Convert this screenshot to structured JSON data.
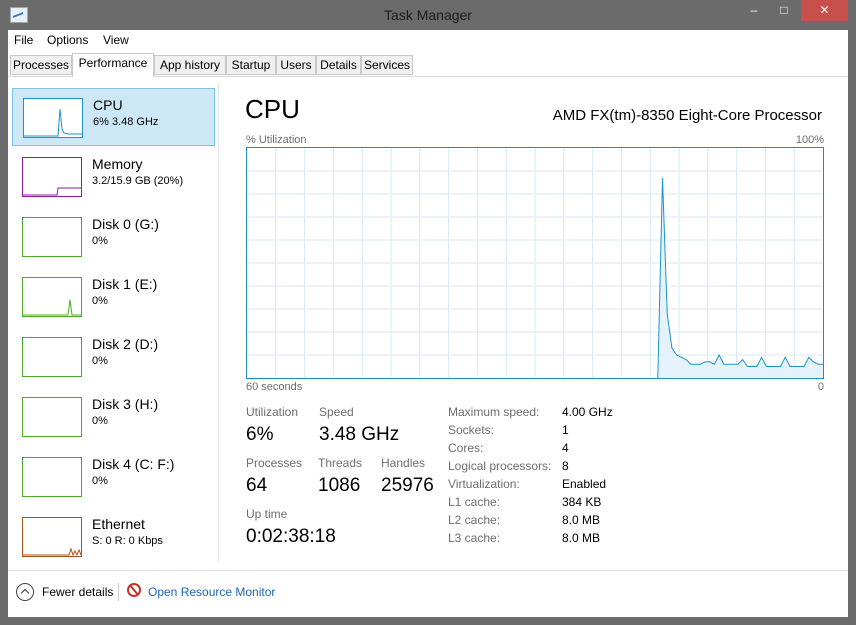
{
  "window": {
    "title": "Task Manager"
  },
  "window_controls": {
    "minimize": "–",
    "maximize": "□",
    "close": "✕"
  },
  "menu": [
    "File",
    "Options",
    "View"
  ],
  "tabs": [
    "Processes",
    "Performance",
    "App history",
    "Startup",
    "Users",
    "Details",
    "Services"
  ],
  "active_tab": "Performance",
  "sidebar": {
    "items": [
      {
        "name": "CPU",
        "sub": "6% 3.48 GHz",
        "color": "#1a94cb",
        "selected": true
      },
      {
        "name": "Memory",
        "sub": "3.2/15.9 GB (20%)",
        "color": "#8b1c9e"
      },
      {
        "name": "Disk 0 (G:)",
        "sub": "0%",
        "color": "#4da82a"
      },
      {
        "name": "Disk 1 (E:)",
        "sub": "0%",
        "color": "#4da82a"
      },
      {
        "name": "Disk 2 (D:)",
        "sub": "0%",
        "color": "#4da82a"
      },
      {
        "name": "Disk 3 (H:)",
        "sub": "0%",
        "color": "#4da82a"
      },
      {
        "name": "Disk 4 (C: F:)",
        "sub": "0%",
        "color": "#4da82a"
      },
      {
        "name": "Ethernet",
        "sub": "S: 0 R: 0 Kbps",
        "color": "#a7541b"
      }
    ]
  },
  "main": {
    "title": "CPU",
    "processor": "AMD FX(tm)-8350 Eight-Core Processor",
    "util_label": "% Utilization",
    "util_max": "100%",
    "time_left": "60 seconds",
    "time_right": "0",
    "graph_color": "#1a94cb",
    "graph_values": [
      0,
      0,
      0,
      0,
      0,
      0,
      0,
      0,
      0,
      0,
      0,
      0,
      0,
      0,
      0,
      0,
      0,
      0,
      0,
      0,
      0,
      0,
      0,
      0,
      0,
      0,
      0,
      0,
      0,
      0,
      0,
      0,
      0,
      0,
      0,
      0,
      0,
      0,
      0,
      0,
      0,
      0,
      0,
      0,
      0,
      0,
      0,
      0,
      0,
      0,
      0,
      0,
      0,
      0,
      0,
      0,
      0,
      0,
      0,
      0,
      0,
      0,
      0,
      0,
      0,
      0,
      0,
      0,
      0,
      0,
      0,
      0,
      0,
      0,
      0,
      0,
      0,
      0,
      0,
      0,
      0,
      0,
      0,
      0,
      0,
      0,
      0,
      0,
      87,
      28,
      13,
      10,
      9,
      8,
      6,
      6,
      6,
      7,
      7,
      6,
      10,
      6,
      6,
      6,
      6,
      8,
      5,
      5,
      5,
      9,
      5,
      5,
      5,
      5,
      9,
      5,
      5,
      5,
      5,
      9,
      7,
      6,
      6
    ],
    "stats": {
      "utilization_label": "Utilization",
      "utilization": "6%",
      "speed_label": "Speed",
      "speed": "3.48 GHz",
      "processes_label": "Processes",
      "processes": "64",
      "threads_label": "Threads",
      "threads": "1086",
      "handles_label": "Handles",
      "handles": "25976",
      "uptime_label": "Up time",
      "uptime": "0:02:38:18"
    },
    "info": [
      {
        "label": "Maximum speed:",
        "value": "4.00 GHz"
      },
      {
        "label": "Sockets:",
        "value": "1"
      },
      {
        "label": "Cores:",
        "value": "4"
      },
      {
        "label": "Logical processors:",
        "value": "8"
      },
      {
        "label": "Virtualization:",
        "value": "Enabled"
      },
      {
        "label": "L1 cache:",
        "value": "384 KB"
      },
      {
        "label": "L2 cache:",
        "value": "8.0 MB"
      },
      {
        "label": "L3 cache:",
        "value": "8.0 MB"
      }
    ]
  },
  "footer": {
    "fewer_details": "Fewer details",
    "resource_monitor": "Open Resource Monitor"
  }
}
